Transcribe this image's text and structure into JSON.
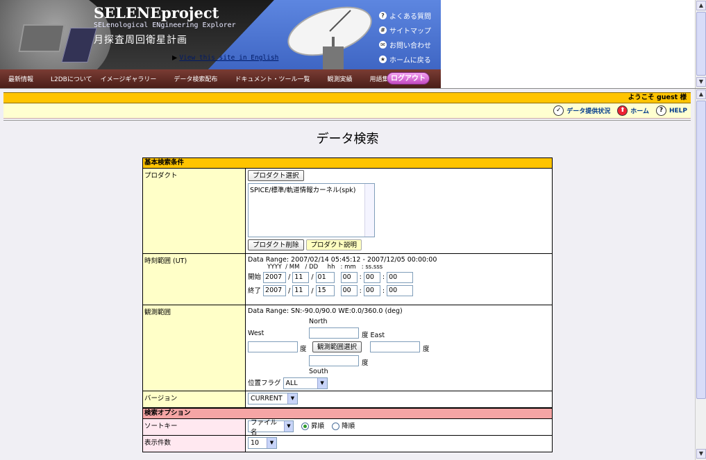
{
  "banner": {
    "title": "SELENEproject",
    "subtitle": "SELenological ENgineering Explorer",
    "jp_title": "月探査周回衛星計画",
    "english_link": "View this site in English",
    "side_links": [
      {
        "icon": "question-icon",
        "glyph": "?",
        "label": "よくある質問"
      },
      {
        "icon": "sitemap-icon",
        "glyph": "#",
        "label": "サイトマップ"
      },
      {
        "icon": "mail-icon",
        "glyph": "✉",
        "label": "お問い合わせ"
      },
      {
        "icon": "home-icon",
        "glyph": "★",
        "label": "ホームに戻る"
      }
    ],
    "nav": [
      "最新情報",
      "L2DBについて",
      "イメージギャラリー",
      "データ検索配布",
      "ドキュメント・ツール一覧",
      "観測実績",
      "用語集"
    ],
    "logout": "ログアウト"
  },
  "header": {
    "welcome": "ようこそ guest 様",
    "links": [
      {
        "icon": "checkmark-icon",
        "glyph": "✓",
        "label": "データ提供状況"
      },
      {
        "icon": "home-up-icon",
        "glyph": "⬆",
        "label": "ホーム"
      },
      {
        "icon": "help-icon",
        "glyph": "?",
        "label": "HELP"
      }
    ]
  },
  "page_title": "データ検索",
  "form": {
    "basic_section": "基本検索条件",
    "product": {
      "label": "プロダクト",
      "select_button": "プロダクト選択",
      "selected_item": "SPICE/標準/軌道情報カーネル(spk)",
      "delete_button": "プロダクト削除",
      "describe_button": "プロダクト説明"
    },
    "time": {
      "label": "時刻範囲 (UT)",
      "range_text": "Data Range: 2007/02/14 05:45:12 - 2007/12/05 00:00:00",
      "col_head": "YYYY  / MM   / DD     hh   : mm   : ss.sss",
      "start_label": "開始",
      "end_label": "終了",
      "start": {
        "y": "2007",
        "m": "11",
        "d": "01",
        "hh": "00",
        "mm": "00",
        "ss": "00"
      },
      "end": {
        "y": "2007",
        "m": "11",
        "d": "15",
        "hh": "00",
        "mm": "00",
        "ss": "00"
      }
    },
    "obs": {
      "label": "観測範囲",
      "range_text": "Data Range: SN:-90.0/90.0 WE:0.0/360.0 (deg)",
      "north": "North",
      "south": "South",
      "west": "West",
      "east": "East",
      "deg": "度",
      "select_button": "観測範囲選択",
      "flag_label": "位置フラグ",
      "flag_value": "ALL"
    },
    "version": {
      "label": "バージョン",
      "value": "CURRENT"
    },
    "option_section": "検索オプション",
    "sort": {
      "label": "ソートキー",
      "value": "ファイル名",
      "asc": "昇順",
      "desc": "降順"
    },
    "count": {
      "label": "表示件数",
      "value": "10"
    }
  }
}
